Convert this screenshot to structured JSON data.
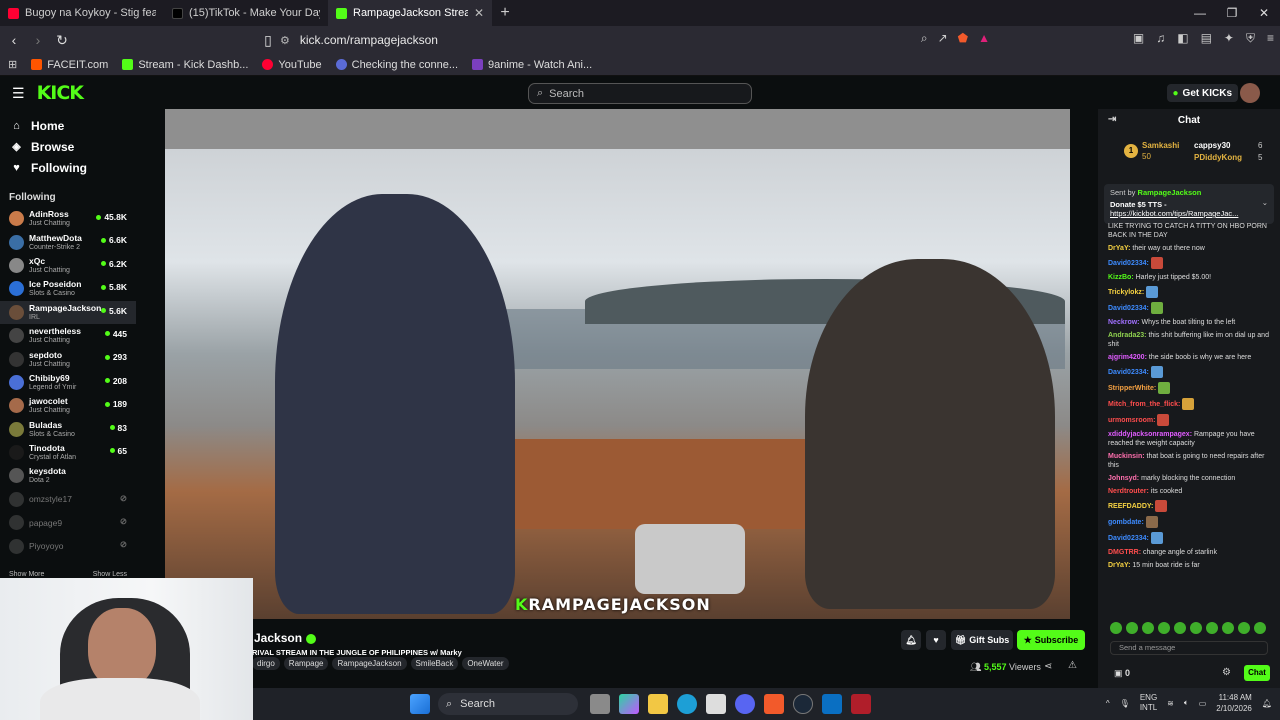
{
  "browser": {
    "tabs": [
      {
        "title": "Bugoy na Koykoy - Stig feat. Flow G",
        "favicon_color": "#ff0033",
        "active": false
      },
      {
        "title": "(15)TikTok - Make Your Day",
        "favicon_color": "#111111",
        "active": false
      },
      {
        "title": "RampageJackson Stream - Watc",
        "favicon_color": "#53fc18",
        "active": true
      }
    ],
    "url": "kick.com/rampagejackson",
    "bookmarks": [
      {
        "label": "FACEIT.com",
        "color": "#ff5500"
      },
      {
        "label": "Stream - Kick Dashb...",
        "color": "#53fc18"
      },
      {
        "label": "YouTube",
        "color": "#ff0033"
      },
      {
        "label": "Checking the conne...",
        "color": "#5b6bd6"
      },
      {
        "label": "9anime - Watch Ani...",
        "color": "#7b3fbf"
      }
    ]
  },
  "kick": {
    "logo": "KICK",
    "search_placeholder": "Search",
    "get_kicks": "Get KICKs",
    "nav": [
      {
        "label": "Home",
        "icon": "home-icon"
      },
      {
        "label": "Browse",
        "icon": "compass-icon"
      },
      {
        "label": "Following",
        "icon": "heart-icon"
      }
    ],
    "following_heading": "Following",
    "channels": [
      {
        "name": "AdinRoss",
        "category": "Just Chatting",
        "viewers": "45.8K",
        "color": "#c97b4a"
      },
      {
        "name": "MatthewDota",
        "category": "Counter-Strike 2",
        "viewers": "6.6K",
        "color": "#3a6ea5"
      },
      {
        "name": "xQc",
        "category": "Just Chatting",
        "viewers": "6.2K",
        "color": "#888888"
      },
      {
        "name": "Ice Poseidon",
        "category": "Slots & Casino",
        "viewers": "5.8K",
        "color": "#2b6fd6"
      },
      {
        "name": "RampageJackson",
        "category": "IRL",
        "viewers": "5.6K",
        "color": "#6a4e3a",
        "selected": true
      },
      {
        "name": "nevertheless",
        "category": "Just Chatting",
        "viewers": "445",
        "color": "#444444"
      },
      {
        "name": "sepdoto",
        "category": "Just Chatting",
        "viewers": "293",
        "color": "#333333"
      },
      {
        "name": "Chibiby69",
        "category": "Legend of Ymir",
        "viewers": "208",
        "color": "#4a6fd6"
      },
      {
        "name": "jawocolet",
        "category": "Just Chatting",
        "viewers": "189",
        "color": "#a56a4a"
      },
      {
        "name": "Buladas",
        "category": "Slots & Casino",
        "viewers": "83",
        "color": "#7a7a3a"
      },
      {
        "name": "Tinodota",
        "category": "Crystal of Atlan",
        "viewers": "65",
        "color": "#1a1a1a"
      },
      {
        "name": "keysdota",
        "category": "Dota 2",
        "viewers": "",
        "color": "#555555"
      },
      {
        "name": "omzstyle17",
        "category": "",
        "viewers": "",
        "color": "#555555",
        "offline": true
      },
      {
        "name": "papage9",
        "category": "",
        "viewers": "",
        "color": "#555555",
        "offline": true
      },
      {
        "name": "Piyoyoyo",
        "category": "",
        "viewers": "",
        "color": "#555555",
        "offline": true
      }
    ],
    "show_more": "Show More",
    "show_less": "Show Less",
    "watermark_k": "K",
    "watermark_text": "RAMPAGEJACKSON"
  },
  "stream": {
    "name": "Jackson",
    "title": "RIVAL STREAM IN THE JUNGLE OF PHILIPPINES w/ Marky",
    "tags": [
      "dirgo",
      "Rampage",
      "RampageJackson",
      "SmileBack",
      "OneWater"
    ],
    "gift_subs": "Gift Subs",
    "subscribe": "Subscribe",
    "viewers": "5,557",
    "viewers_label": "Viewers"
  },
  "chat": {
    "title": "Chat",
    "leaderboard": [
      {
        "rank": "1",
        "name": "Samkashi",
        "count": "50"
      },
      {
        "name": "cappsy30",
        "count": "6"
      },
      {
        "name": "PDiddyKong",
        "count": "5"
      }
    ],
    "pinned_sent_by": "Sent by",
    "pinned_user": "RampageJackson",
    "pinned_line1": "Donate $5 TTS -",
    "pinned_link": "https://kickbot.com/tips/RampageJac...",
    "messages": [
      {
        "user": "",
        "color": "#dddddd",
        "text": "LIKE TRYING TO CATCH A TITTY ON HBO PORN BACK IN THE DAY"
      },
      {
        "user": "DrYaY:",
        "color": "#f5d142",
        "text": "their way out there now"
      },
      {
        "user": "David02334:",
        "color": "#3d8bff",
        "text": ""
      },
      {
        "user": "KizzBo:",
        "color": "#53fc18",
        "text": "Harley just tipped $5.00!"
      },
      {
        "user": "Trickylokz:",
        "color": "#f5d142",
        "text": ""
      },
      {
        "user": "David02334:",
        "color": "#3d8bff",
        "text": ""
      },
      {
        "user": "Neckrow:",
        "color": "#a070ff",
        "text": "Whys the boat tilting to the left"
      },
      {
        "user": "Andrada23:",
        "color": "#8fd14f",
        "text": "this shit buffering like im on dial up and shit"
      },
      {
        "user": "ajgrim4200:",
        "color": "#e05cff",
        "text": "the side boob is why we are here"
      },
      {
        "user": "David02334:",
        "color": "#3d8bff",
        "text": ""
      },
      {
        "user": "StripperWhite:",
        "color": "#f5a142",
        "text": ""
      },
      {
        "user": "Mitch_from_the_flick:",
        "color": "#ff4d4d",
        "text": ""
      },
      {
        "user": "urmomsroom:",
        "color": "#ff4d4d",
        "text": ""
      },
      {
        "user": "xdiddyjacksonrampagex:",
        "color": "#e05cff",
        "text": "Rampage you have reached the weight capacity"
      },
      {
        "user": "Muckinsin:",
        "color": "#ff6fae",
        "text": "that boat is going to need repairs after this"
      },
      {
        "user": "Johnsyd:",
        "color": "#ff6fae",
        "text": "marky blocking the connection"
      },
      {
        "user": "Nerdtrouter:",
        "color": "#ff4d4d",
        "text": "its cooked"
      },
      {
        "user": "REEFDADDY:",
        "color": "#f5d142",
        "text": ""
      },
      {
        "user": "gombdate:",
        "color": "#3d8bff",
        "text": ""
      },
      {
        "user": "David02334:",
        "color": "#3d8bff",
        "text": ""
      },
      {
        "user": "DMGTRR:",
        "color": "#ff4d4d",
        "text": "change angle of starlink"
      },
      {
        "user": "DrYaY:",
        "color": "#f5d142",
        "text": "15 min boat ride is far"
      }
    ],
    "send_placeholder": "Send a message",
    "points": "0",
    "chat_button": "Chat"
  },
  "taskbar": {
    "search": "Search",
    "lang_top": "ENG",
    "lang_bottom": "INTL",
    "time": "11:48 AM",
    "date": "2/10/2026"
  }
}
